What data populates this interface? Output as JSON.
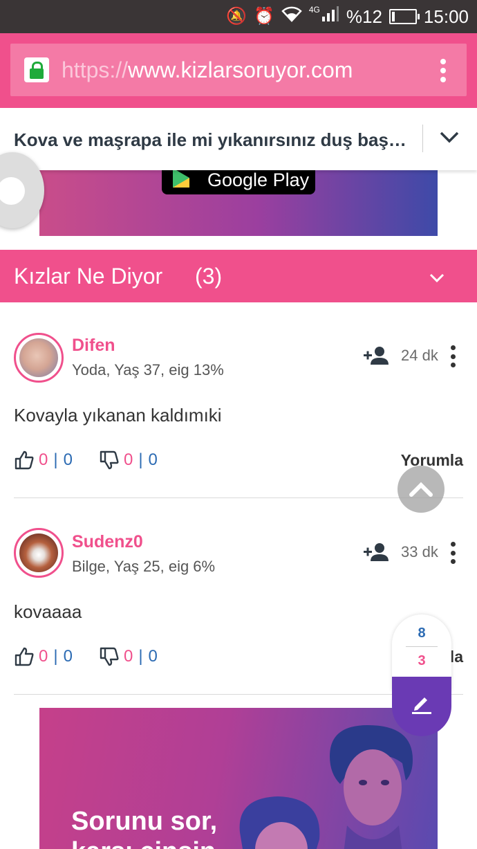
{
  "status_bar": {
    "battery": "%12",
    "battery_level": 0.12,
    "network": "4G",
    "time": "15:00"
  },
  "browser": {
    "url_scheme": "https://",
    "url_host": "www.kizlarsoruyor.com"
  },
  "question": {
    "title": "Kova ve maşrapa ile mi yıkanırsınız duş başlığıyla mı?"
  },
  "top_banner": {
    "store_badge": "Google Play"
  },
  "section": {
    "label": "Kızlar Ne Diyor",
    "count": "(3)"
  },
  "answers": [
    {
      "username": "Difen",
      "meta": "Yoda, Yaş 37, eig 13%",
      "time": "24 dk",
      "text": "Kovayla yıkanan kaldımıki",
      "likes": "0",
      "likes_total": "0",
      "dislikes": "0",
      "dislikes_total": "0",
      "reply_label": "Yorumla"
    },
    {
      "username": "Sudenz0",
      "meta": "Bilge, Yaş 25, eig 6%",
      "time": "33 dk",
      "text": "kovaaaa",
      "likes": "0",
      "likes_total": "0",
      "dislikes": "0",
      "dislikes_total": "0",
      "reply_label": "Yorumla"
    }
  ],
  "counter_widget": {
    "count_top": "8",
    "count_bottom": "3"
  },
  "ad_banner": {
    "line1": "Sorunu sor,",
    "line2": "karşı cinsin"
  },
  "colors": {
    "brand_pink": "#f0508c",
    "link_blue": "#2c6bb3",
    "fab_purple": "#6a3ab4"
  }
}
